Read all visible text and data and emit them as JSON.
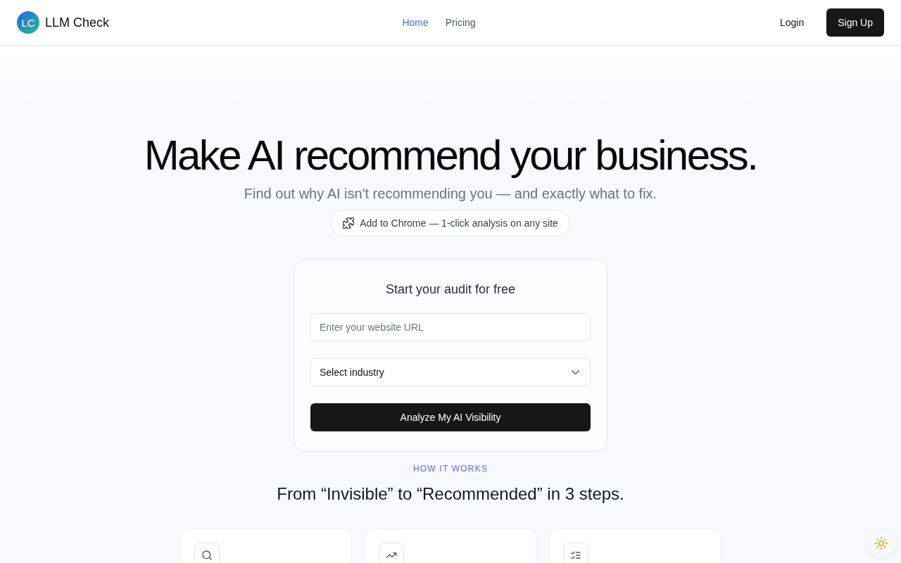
{
  "header": {
    "logo": {
      "initials": "LC",
      "name": "LLM Check"
    },
    "nav": [
      {
        "label": "Home",
        "selected": true
      },
      {
        "label": "Pricing",
        "selected": false
      }
    ],
    "login": "Login",
    "signup": "Sign Up"
  },
  "hero": {
    "title": "Make AI recommend your business.",
    "subtitle": "Find out why AI isn't recommending you — and exactly what to fix.",
    "extension_button": "Add to Chrome — 1-click analysis on any site"
  },
  "audit_form": {
    "title": "Start your audit for free",
    "url_field": {
      "placeholder": "Enter your website URL"
    },
    "industry_select": {
      "value": "Select industry"
    },
    "submit": "Analyze My AI Visibility"
  },
  "how_it_works": {
    "eyebrow": "HOW IT WORKS",
    "title": "From “Invisible” to “Recommended” in 3 steps."
  }
}
